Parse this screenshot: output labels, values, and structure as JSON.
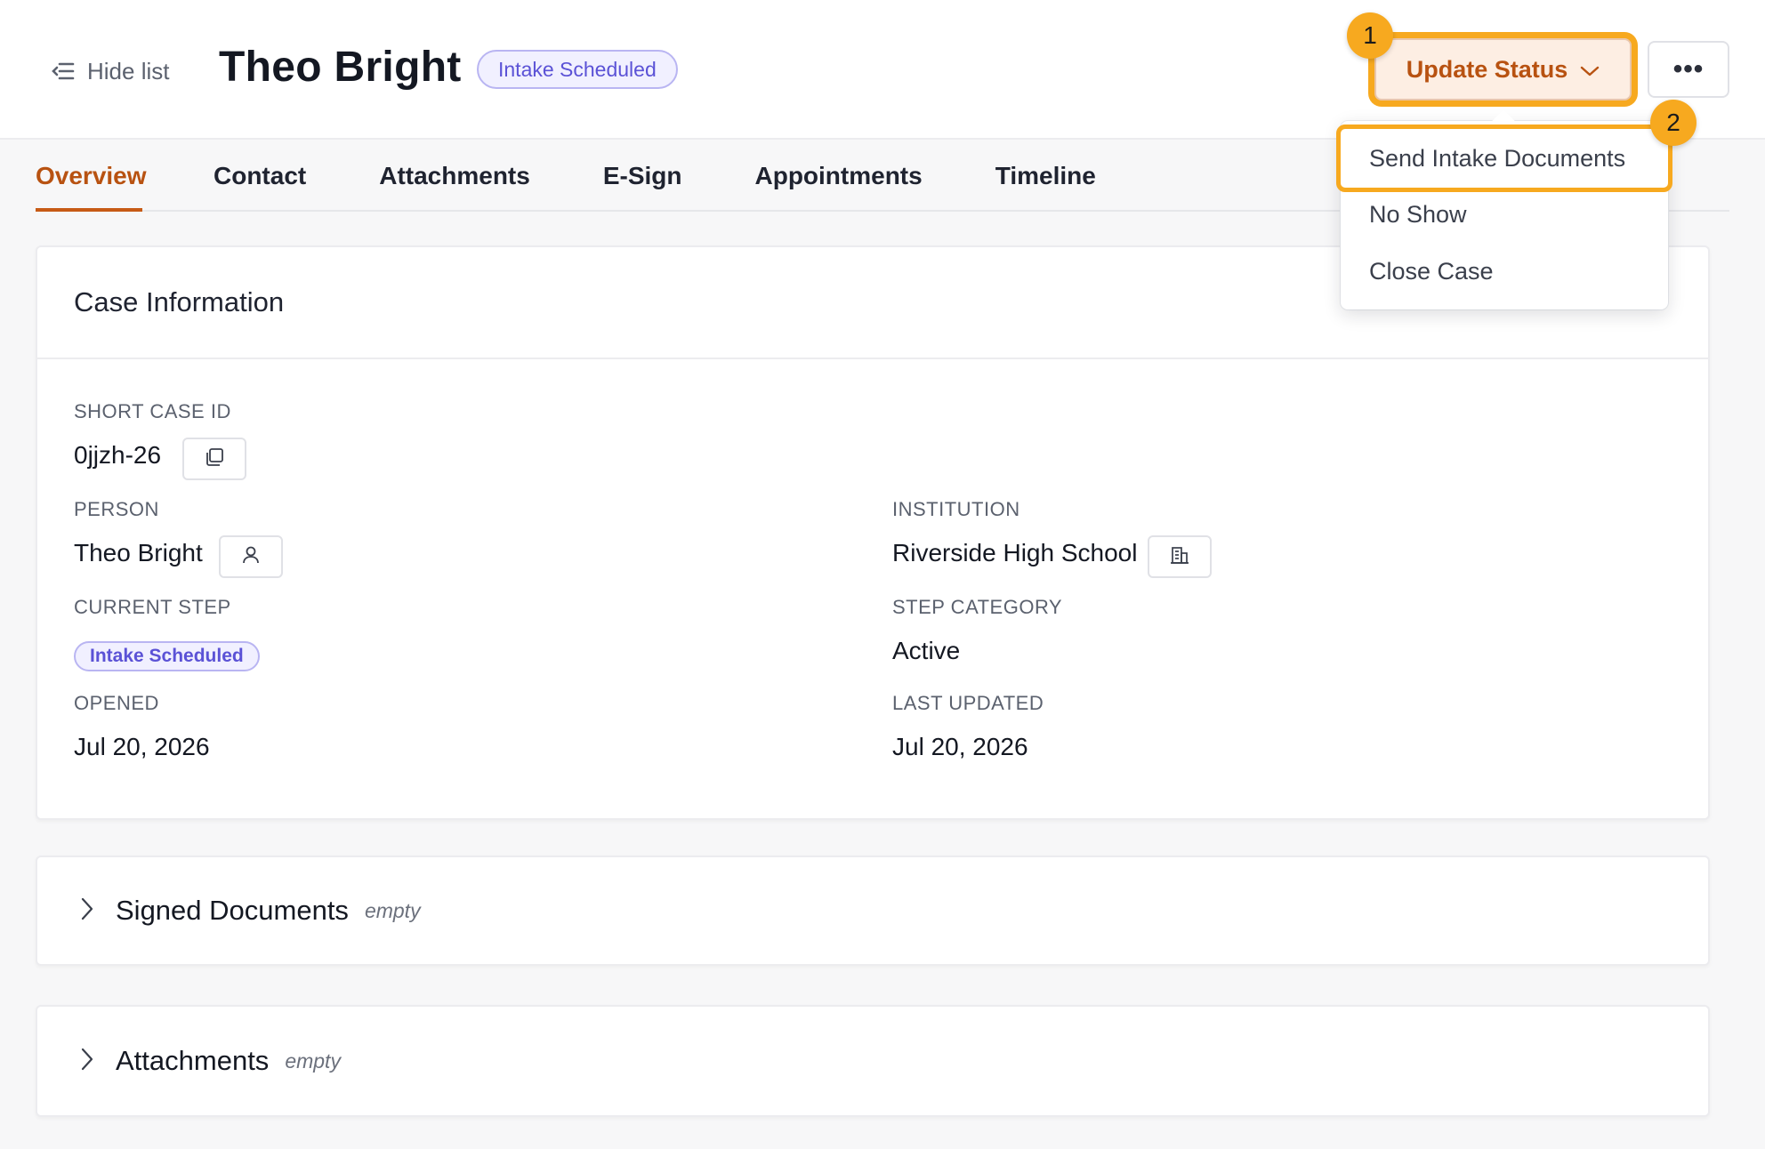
{
  "header": {
    "hide_list_label": "Hide list",
    "case_title": "Theo Bright",
    "status": "Intake Scheduled",
    "update_status_label": "Update Status",
    "more_label": "•••"
  },
  "annotations": {
    "step1": "1",
    "step2": "2"
  },
  "tabs": [
    {
      "label": "Overview",
      "active": true
    },
    {
      "label": "Contact"
    },
    {
      "label": "Attachments"
    },
    {
      "label": "E-Sign"
    },
    {
      "label": "Appointments"
    },
    {
      "label": "Timeline"
    }
  ],
  "dropdown": {
    "items": [
      {
        "label": "Send Intake Documents"
      },
      {
        "label": "No Show"
      },
      {
        "label": "Close Case"
      }
    ]
  },
  "case_info": {
    "title": "Case Information",
    "short_case_id_label": "SHORT CASE ID",
    "short_case_id": "0jjzh-26",
    "person_label": "PERSON",
    "person": "Theo Bright",
    "institution_label": "INSTITUTION",
    "institution": "Riverside High School",
    "current_step_label": "CURRENT STEP",
    "current_step": "Intake Scheduled",
    "step_category_label": "STEP CATEGORY",
    "step_category": "Active",
    "opened_label": "OPENED",
    "opened": "Jul 20, 2026",
    "last_updated_label": "LAST UPDATED",
    "last_updated": "Jul 20, 2026"
  },
  "sections": {
    "signed_documents": {
      "title": "Signed Documents",
      "empty": "empty"
    },
    "attachments": {
      "title": "Attachments",
      "empty": "empty"
    }
  },
  "colors": {
    "accent": "#c75b16",
    "highlight": "#f7a91f",
    "pill_text": "#5b52d6",
    "pill_bg": "#f1f0ff"
  },
  "icons": [
    "list-collapse-icon",
    "chevron-down-icon",
    "more-horizontal-icon",
    "copy-icon",
    "user-icon",
    "building-icon",
    "chevron-right-icon"
  ]
}
